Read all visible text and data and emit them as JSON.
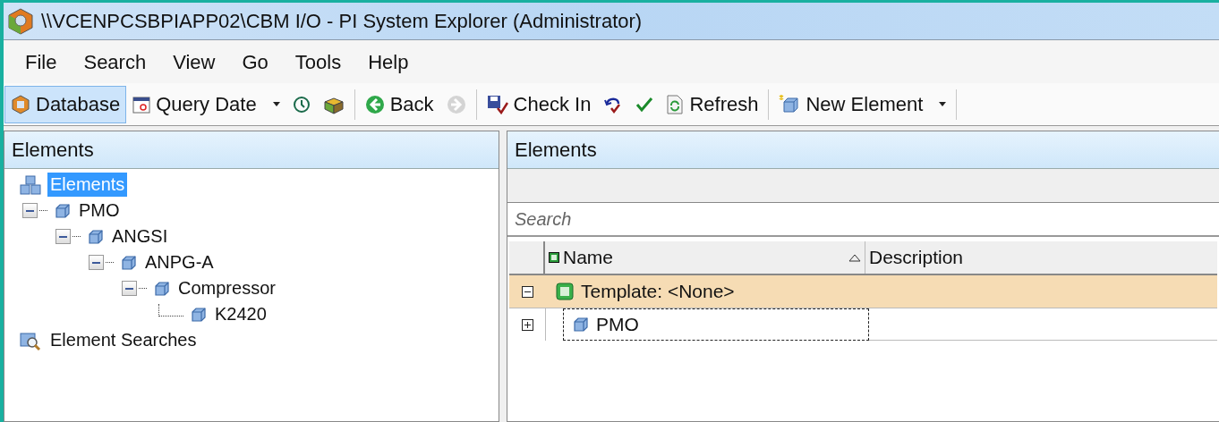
{
  "window": {
    "title": "\\\\VCENPCSBPIAPP02\\CBM I/O - PI System Explorer (Administrator)"
  },
  "menu": [
    "File",
    "Search",
    "View",
    "Go",
    "Tools",
    "Help"
  ],
  "toolbar": [
    {
      "kind": "button",
      "label": "Database",
      "selected": true,
      "disabled": false
    },
    {
      "kind": "dropdown",
      "label": "Query Date",
      "selected": false,
      "disabled": false
    },
    {
      "kind": "icon",
      "selected": false,
      "disabled": false
    },
    {
      "kind": "icon",
      "selected": false,
      "disabled": false
    },
    {
      "kind": "separator"
    },
    {
      "kind": "button",
      "label": "Back",
      "selected": false,
      "disabled": false
    },
    {
      "kind": "icon",
      "selected": false,
      "disabled": true
    },
    {
      "kind": "separator"
    },
    {
      "kind": "button",
      "label": "Check In",
      "selected": false,
      "disabled": false
    },
    {
      "kind": "icon",
      "selected": false,
      "disabled": false
    },
    {
      "kind": "icon",
      "selected": false,
      "disabled": false
    },
    {
      "kind": "button",
      "label": "Refresh",
      "selected": false,
      "disabled": false
    },
    {
      "kind": "separator"
    },
    {
      "kind": "dropdown",
      "label": "New Element",
      "selected": false,
      "disabled": false
    },
    {
      "kind": "separator"
    }
  ],
  "left_pane": {
    "title": "Elements",
    "tree": [
      {
        "kind": "root",
        "label": "Elements",
        "selected": true,
        "children": [
          {
            "kind": "element",
            "label": "PMO",
            "selected": false,
            "expanded": true,
            "children": [
              {
                "kind": "element",
                "label": "ANGSI",
                "selected": false,
                "expanded": true,
                "children": [
                  {
                    "kind": "element",
                    "label": "ANPG-A",
                    "selected": false,
                    "expanded": true,
                    "children": [
                      {
                        "kind": "element",
                        "label": "Compressor",
                        "selected": false,
                        "expanded": true,
                        "children": [
                          {
                            "kind": "element",
                            "label": "K2420",
                            "selected": false
                          }
                        ]
                      }
                    ]
                  }
                ]
              }
            ]
          }
        ]
      },
      {
        "kind": "searches",
        "label": "Element Searches",
        "selected": false
      }
    ]
  },
  "right_pane": {
    "title": "Elements",
    "search": {
      "placeholder": "Search"
    },
    "columns": [
      {
        "label": "Name",
        "sorted": true
      },
      {
        "label": "Description",
        "sorted": false
      }
    ],
    "group": {
      "label": "Template: <None>",
      "expanded": true
    },
    "rows": [
      {
        "name": "PMO",
        "expanded": false,
        "focused": true
      }
    ]
  }
}
